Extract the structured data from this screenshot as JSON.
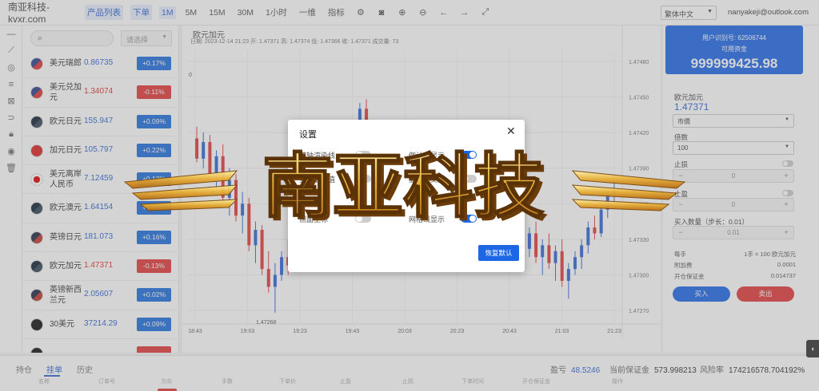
{
  "topbar": {
    "brand": "南亚科技-kvxr.com",
    "buttons": [
      "产品列表",
      "下单",
      "1M",
      "5M",
      "15M",
      "30M",
      "1小时",
      "一维",
      "指标"
    ],
    "active_buttons": [
      0,
      1,
      2
    ],
    "language": "繁体中文",
    "email": "nanyakeji@outlook.com"
  },
  "symbols": {
    "search_placeholder": "",
    "filter_label": "请选择",
    "rows": [
      {
        "name": "美元瑞郎",
        "price": "0.86735",
        "change": "+0.17%",
        "dir": "up",
        "flag": "a"
      },
      {
        "name": "美元兑加元",
        "price": "1.34074",
        "change": "-0.11%",
        "dir": "down",
        "flag": "a"
      },
      {
        "name": "欧元日元",
        "price": "155.947",
        "change": "+0.09%",
        "dir": "up",
        "flag": "e"
      },
      {
        "name": "加元日元",
        "price": "105.797",
        "change": "+0.22%",
        "dir": "up",
        "flag": "d"
      },
      {
        "name": "美元离岸人民币",
        "price": "7.12459",
        "change": "+0.12%",
        "dir": "up",
        "flag": "c"
      },
      {
        "name": "欧元澳元",
        "price": "1.64154",
        "change": "+0.02%",
        "dir": "up",
        "flag": "e"
      },
      {
        "name": "英镑日元",
        "price": "181.073",
        "change": "+0.16%",
        "dir": "up",
        "flag": "b"
      },
      {
        "name": "欧元加元",
        "price": "1.47371",
        "change": "-0.13%",
        "dir": "down",
        "flag": "e"
      },
      {
        "name": "英镑新西兰元",
        "price": "2.05607",
        "change": "+0.02%",
        "dir": "up",
        "flag": "b"
      },
      {
        "name": "30美元",
        "price": "37214.29",
        "change": "+0.09%",
        "dir": "up",
        "flag": "f"
      },
      {
        "name": "",
        "price": "",
        "change": "",
        "dir": "down",
        "flag": "f"
      }
    ]
  },
  "chart": {
    "title": "欧元加元",
    "ohlc": "日期: 2023-12-14 21:23   开: 1.47371   高: 1.47374   低: 1.47366   收: 1.47371   成交量: 73",
    "low_label": "1.47268",
    "high_label": "",
    "marker_label": "0"
  },
  "chart_data": {
    "type": "candlestick",
    "x_ticks": [
      "18:43",
      "19:03",
      "19:23",
      "19:43",
      "20:03",
      "20:23",
      "20:43",
      "21:03",
      "21:23"
    ],
    "y_ticks": [
      "1.47480",
      "1.47450",
      "1.47420",
      "1.47390",
      "1.47360",
      "1.47330",
      "1.47300",
      "1.47270"
    ],
    "ylim": [
      1.4726,
      1.4749
    ],
    "up_color": "#2f66d6",
    "down_color": "#e23a3a",
    "candles": [
      [
        1.47415,
        1.47425,
        1.47395,
        1.47398
      ],
      [
        1.47398,
        1.4742,
        1.4739,
        1.47412
      ],
      [
        1.47412,
        1.47418,
        1.4738,
        1.47385
      ],
      [
        1.47385,
        1.47405,
        1.47372,
        1.474
      ],
      [
        1.474,
        1.4741,
        1.4736,
        1.47365
      ],
      [
        1.47365,
        1.4739,
        1.4735,
        1.4738
      ],
      [
        1.4738,
        1.47385,
        1.47345,
        1.4735
      ],
      [
        1.4735,
        1.4737,
        1.47335,
        1.4736
      ],
      [
        1.4736,
        1.47365,
        1.4732,
        1.47325
      ],
      [
        1.47325,
        1.47345,
        1.4731,
        1.47338
      ],
      [
        1.47338,
        1.47342,
        1.473,
        1.47305
      ],
      [
        1.47305,
        1.4732,
        1.47285,
        1.4729
      ],
      [
        1.4729,
        1.4731,
        1.47268,
        1.473
      ],
      [
        1.473,
        1.4732,
        1.47295,
        1.47315
      ],
      [
        1.47315,
        1.4733,
        1.473,
        1.47308
      ],
      [
        1.47308,
        1.47335,
        1.47305,
        1.4733
      ],
      [
        1.4733,
        1.47345,
        1.4732,
        1.47325
      ],
      [
        1.47325,
        1.4735,
        1.47318,
        1.47345
      ],
      [
        1.47345,
        1.4736,
        1.4733,
        1.47335
      ],
      [
        1.47335,
        1.47365,
        1.4733,
        1.4736
      ],
      [
        1.4736,
        1.4738,
        1.4735,
        1.47355
      ],
      [
        1.47355,
        1.4739,
        1.47352,
        1.47385
      ],
      [
        1.47385,
        1.47395,
        1.47365,
        1.4737
      ],
      [
        1.4737,
        1.474,
        1.47365,
        1.47395
      ],
      [
        1.47395,
        1.4742,
        1.4739,
        1.47415
      ],
      [
        1.47415,
        1.47445,
        1.4741,
        1.4744
      ],
      [
        1.4744,
        1.47448,
        1.474,
        1.47405
      ],
      [
        1.47405,
        1.4741,
        1.4737,
        1.47375
      ],
      [
        1.47375,
        1.47385,
        1.4735,
        1.47355
      ],
      [
        1.47355,
        1.47365,
        1.47335,
        1.4734
      ],
      [
        1.4734,
        1.4736,
        1.4733,
        1.47352
      ],
      [
        1.47352,
        1.4737,
        1.47345,
        1.47365
      ],
      [
        1.47365,
        1.47375,
        1.4735,
        1.47355
      ],
      [
        1.47355,
        1.4738,
        1.4735,
        1.47375
      ],
      [
        1.47375,
        1.4739,
        1.47365,
        1.4737
      ],
      [
        1.4737,
        1.47385,
        1.47355,
        1.4738
      ],
      [
        1.4738,
        1.47392,
        1.47368,
        1.47372
      ],
      [
        1.47372,
        1.4738,
        1.47355,
        1.4736
      ],
      [
        1.4736,
        1.47378,
        1.47352,
        1.4737
      ],
      [
        1.4737,
        1.47375,
        1.4734,
        1.47345
      ],
      [
        1.47345,
        1.4736,
        1.47335,
        1.47355
      ],
      [
        1.47355,
        1.47365,
        1.4734,
        1.47348
      ],
      [
        1.47348,
        1.4737,
        1.47345,
        1.47365
      ],
      [
        1.47365,
        1.4738,
        1.47358,
        1.47375
      ],
      [
        1.47375,
        1.47388,
        1.47365,
        1.4737
      ],
      [
        1.4737,
        1.47375,
        1.47345,
        1.4735
      ],
      [
        1.4735,
        1.47362,
        1.4734,
        1.47358
      ],
      [
        1.47358,
        1.47368,
        1.4734,
        1.47345
      ],
      [
        1.47345,
        1.4736,
        1.4733,
        1.47355
      ],
      [
        1.47355,
        1.47365,
        1.4733,
        1.47335
      ],
      [
        1.47335,
        1.47348,
        1.47318,
        1.47322
      ],
      [
        1.47322,
        1.4734,
        1.47315,
        1.47335
      ],
      [
        1.47335,
        1.47345,
        1.4731,
        1.47315
      ],
      [
        1.47315,
        1.4733,
        1.473,
        1.47325
      ],
      [
        1.47325,
        1.47335,
        1.47305,
        1.4731
      ],
      [
        1.4731,
        1.47325,
        1.47295,
        1.4732
      ],
      [
        1.4732,
        1.4733,
        1.4729,
        1.47295
      ],
      [
        1.47295,
        1.4731,
        1.4728,
        1.47305
      ],
      [
        1.47305,
        1.4732,
        1.473,
        1.47315
      ],
      [
        1.47315,
        1.4733,
        1.47305,
        1.47325
      ],
      [
        1.47325,
        1.47345,
        1.47318,
        1.4734
      ],
      [
        1.4734,
        1.4735,
        1.4733,
        1.47335
      ],
      [
        1.47335,
        1.4736,
        1.47332,
        1.47355
      ],
      [
        1.47355,
        1.47372,
        1.47348,
        1.47368
      ],
      [
        1.47368,
        1.4738,
        1.4736,
        1.47371
      ]
    ]
  },
  "right_panel": {
    "account_label": "用户识别号: 62506744",
    "funds_label": "可用资金",
    "balance": "999999425.98",
    "symbol": "欧元加元",
    "price": "1.47371",
    "order_type": "市價",
    "leverage_label": "倍数",
    "leverage": "100",
    "stop_loss_label": "止损",
    "stop_loss": "0",
    "take_profit_label": "止盈",
    "take_profit": "0",
    "qty_label": "买入数量（步长：0.01）",
    "qty": "0.01",
    "info": [
      {
        "k": "每手",
        "v": "1手 = 100 欧元加元"
      },
      {
        "k": "附加费",
        "v": "0.0001"
      },
      {
        "k": "开仓保证金",
        "v": "0.014737"
      }
    ],
    "buy": "买入",
    "sell": "卖出"
  },
  "bottom": {
    "tabs": [
      "持仓",
      "挂单",
      "历史"
    ],
    "active_tab": 1,
    "stats": [
      {
        "k": "盈亏",
        "v": "48.5246",
        "blue": true
      },
      {
        "k": "当前保证金",
        "v": "573.998213",
        "blue": false
      },
      {
        "k": "风险率",
        "v": "174216578.704192%",
        "blue": false
      }
    ],
    "columns": [
      "名称",
      "订单号",
      "方向",
      "手数",
      "下单价",
      "止盈",
      "止损",
      "下单时间",
      "开仓保证金",
      "操作"
    ]
  },
  "modal": {
    "title": "设置",
    "close": "✕",
    "options": [
      {
        "label": "横轴渲染线",
        "on": false
      },
      {
        "label": "倒计时显示",
        "on": true
      },
      {
        "label": "显示最新值",
        "on": false
      },
      {
        "label": "显示成交量",
        "on": false
      },
      {
        "label": "侧面坐标",
        "on": false
      },
      {
        "label": "网格线显示",
        "on": true
      }
    ],
    "restore": "恢复默认"
  },
  "watermark": {
    "text": "南亚科技"
  }
}
